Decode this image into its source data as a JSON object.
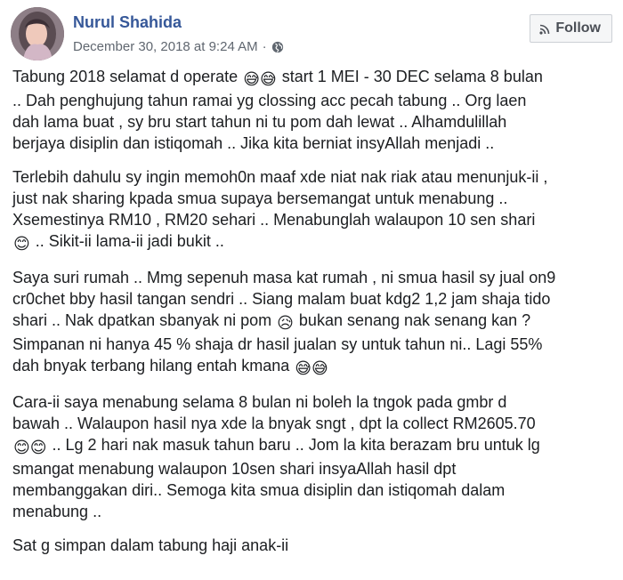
{
  "author": {
    "name": "Nurul Shahida",
    "timestamp": "December 30, 2018 at 9:24 AM",
    "separator": "·",
    "privacy_icon": "globe-icon"
  },
  "follow_button": {
    "label": "Follow",
    "icon": "rss-icon"
  },
  "post": {
    "paragraphs": [
      {
        "lines": [
          [
            "Tabung 2018 selamat d operate ",
            "😅😅",
            " start 1 MEI - 30 DEC selama 8 bulan"
          ],
          [
            ".. Dah penghujung tahun ramai yg clossing acc pecah tabung .. Org laen"
          ],
          [
            "dah lama buat , sy bru start tahun ni tu pom dah lewat .. Alhamdulillah"
          ],
          [
            "berjaya disiplin dan istiqomah .. Jika kita berniat insyAllah menjadi .."
          ]
        ]
      },
      {
        "lines": [
          [
            "Terlebih dahulu sy ingin memoh0n maaf xde niat nak riak atau menunjuk-ii ,"
          ],
          [
            "just nak sharing kpada smua supaya bersemangat untuk menabung .."
          ],
          [
            "Xsemestinya RM10 , RM20 sehari .. Menabunglah walaupon 10 sen shari"
          ],
          [
            "",
            "😊",
            " .. Sikit-ii lama-ii jadi bukit .."
          ]
        ]
      },
      {
        "lines": [
          [
            "Saya suri rumah .. Mmg sepenuh masa kat rumah , ni smua hasil sy jual on9"
          ],
          [
            "cr0chet bby hasil tangan sendri .. Siang malam buat kdg2 1,2 jam shaja tido"
          ],
          [
            "shari .. Nak dpatkan sbanyak ni pom ",
            "😥",
            " bukan senang nak senang kan ?"
          ],
          [
            "Simpanan ni hanya 45 % shaja dr hasil jualan sy untuk tahun ni.. Lagi 55%"
          ],
          [
            "dah bnyak terbang hilang entah kmana ",
            "😅😅"
          ]
        ]
      },
      {
        "lines": [
          [
            "Cara-ii saya menabung selama 8 bulan ni boleh la tngok pada gmbr d"
          ],
          [
            "bawah .. Walaupon hasil nya xde la bnyak sngt , dpt la collect RM2605.70"
          ],
          [
            "",
            "😊😊",
            " .. Lg 2 hari nak masuk tahun baru .. Jom la kita berazam bru untuk lg"
          ],
          [
            "smangat menabung walaupon 10sen shari insyaAllah hasil dpt"
          ],
          [
            "membanggakan diri.. Semoga kita smua disiplin dan istiqomah dalam"
          ],
          [
            "menabung .."
          ]
        ]
      },
      {
        "lines": [
          [
            "Sat g simpan dalam tabung haji anak-ii"
          ]
        ]
      }
    ]
  }
}
